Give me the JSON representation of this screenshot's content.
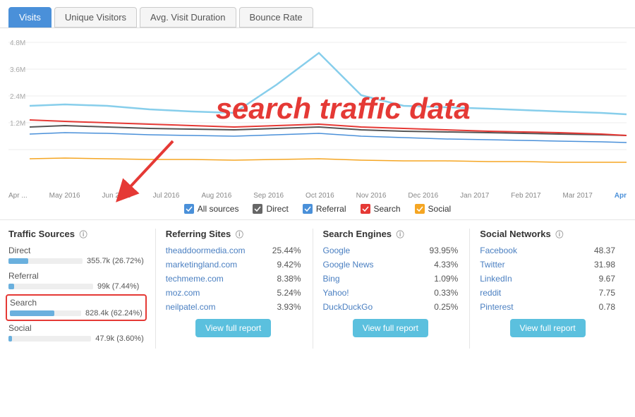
{
  "tabs": [
    {
      "label": "Visits",
      "active": true
    },
    {
      "label": "Unique Visitors",
      "active": false
    },
    {
      "label": "Avg. Visit Duration",
      "active": false
    },
    {
      "label": "Bounce Rate",
      "active": false
    }
  ],
  "chart_overlay": "search traffic data",
  "x_axis_labels": [
    "Apr ...",
    "May 2016",
    "Jun 2016",
    "Jul 2016",
    "Aug 2016",
    "Sep 2016",
    "Oct 2016",
    "Nov 2016",
    "Dec 2016",
    "Jan 2017",
    "Feb 2017",
    "Mar 2017",
    "Apr"
  ],
  "legend": [
    {
      "label": "All sources",
      "color": "#4a90d9",
      "checked": true
    },
    {
      "label": "Direct",
      "color": "#555",
      "checked": true
    },
    {
      "label": "Referral",
      "color": "#4a90d9",
      "checked": true
    },
    {
      "label": "Search",
      "color": "#e53935",
      "checked": true
    },
    {
      "label": "Social",
      "color": "#f5a623",
      "checked": true
    }
  ],
  "traffic_sources": {
    "title": "Traffic Sources",
    "items": [
      {
        "label": "Direct",
        "value": "355.7k (26.72%)",
        "bar_pct": 27,
        "highlight": false
      },
      {
        "label": "Referral",
        "value": "99k (7.44%)",
        "bar_pct": 7,
        "highlight": false
      },
      {
        "label": "Search",
        "value": "828.4k (62.24%)",
        "bar_pct": 62,
        "highlight": true
      },
      {
        "label": "Social",
        "value": "47.9k (3.60%)",
        "bar_pct": 4,
        "highlight": false
      }
    ]
  },
  "referring_sites": {
    "title": "Referring Sites",
    "items": [
      {
        "name": "theaddoormedia.com",
        "value": "25.44%"
      },
      {
        "name": "marketingland.com",
        "value": "9.42%"
      },
      {
        "name": "techmeme.com",
        "value": "8.38%"
      },
      {
        "name": "moz.com",
        "value": "5.24%"
      },
      {
        "name": "neilpatel.com",
        "value": "3.93%"
      }
    ],
    "btn": "View full report"
  },
  "search_engines": {
    "title": "Search Engines",
    "items": [
      {
        "name": "Google",
        "value": "93.95%"
      },
      {
        "name": "Google News",
        "value": "4.33%"
      },
      {
        "name": "Bing",
        "value": "1.09%"
      },
      {
        "name": "Yahoo!",
        "value": "0.33%"
      },
      {
        "name": "DuckDuckGo",
        "value": "0.25%"
      }
    ],
    "btn": "View full report"
  },
  "social_networks": {
    "title": "Social Networks",
    "items": [
      {
        "name": "Facebook",
        "value": "48.37"
      },
      {
        "name": "Twitter",
        "value": "31.98"
      },
      {
        "name": "LinkedIn",
        "value": "9.67"
      },
      {
        "name": "reddit",
        "value": "7.75"
      },
      {
        "name": "Pinterest",
        "value": "0.78"
      }
    ],
    "btn": "View full report"
  }
}
